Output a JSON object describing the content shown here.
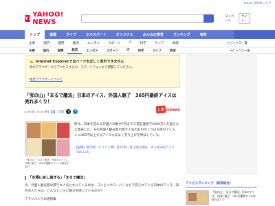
{
  "topbar": {
    "link": "Yahoo! JAPAN ヘルプ"
  },
  "header": {
    "logo_mark": "Y!",
    "logo_text": "YAHOO! NEWS",
    "search_placeholder": "",
    "my_link": "マイページ",
    "site_button": "サイト"
  },
  "nav": {
    "items": [
      "トップ",
      "速報",
      "ライブ",
      "エキスパート",
      "オリジナル",
      "みんなの意見",
      "ランキング",
      "有料"
    ]
  },
  "subnav": {
    "items": [
      "主要",
      "国内",
      "国際",
      "経済",
      "エンタメ",
      "スポーツ",
      "IT",
      "科学",
      "ライフ",
      "地域"
    ],
    "right": "トピックス一覧"
  },
  "catnav": {
    "items": [
      "主要",
      "国内",
      "国際",
      "経済",
      "エンタメ",
      "スポーツ",
      "IT",
      "科学",
      "ライフ",
      "地域"
    ],
    "active_index": 3,
    "right": "トピックス一覧"
  },
  "notice": {
    "title": "Internet Explorerではページを正しく表示できません",
    "body": "他のブラウザーからアクセスするか、スマートフォンから閲覧してください。",
    "link": "推奨ブラウザーについて"
  },
  "article": {
    "title": "「宝の山」「まるで魔法」日本のアイス、外国人魅了　365円最終アイスは売れまくり！",
    "date": "8/26(金) 20:45 配信",
    "comment_count": "1182",
    "sns_x": "X",
    "sns_f": "f",
    "brand_badge": "しま",
    "brand_news": "news",
    "caption": "「宝の山」「まるで魔法」外国人のアイス、外国人魅了。SNS中国籍がアイスの販売を紹介！",
    "body": "昨今、日本を訪れる外国人の数が7月まで三週五連続で2000万人を超えたと発表した。その外国人観光客の間で人気のものの１つは日本のアイス。１つ365円以上するアイスもあまく売り上げを伸ばしている。",
    "link": "【画像】焼き物（バリバリ焼）は20年に及ぶ試行錯誤　大人気SNSアイス「SRLL3Z」",
    "h2": "「本場に戻し過ぎる」「まるで魔法」",
    "para": "今、外国人観光客の間で大人気となっているのが、コンビニやスーパーなどで売られている日本のアイス。海外の人たちは、どんなところに魅力を感じているのか？",
    "para2": "ブラジル人らの感想集"
  },
  "sidebar": {
    "heading": "アクセスランキング（経済総合）",
    "item_text": "「宝の山」「まるで魔法」日本のアイス、外国人魅了　365円最終アイスは売れまくり！"
  }
}
